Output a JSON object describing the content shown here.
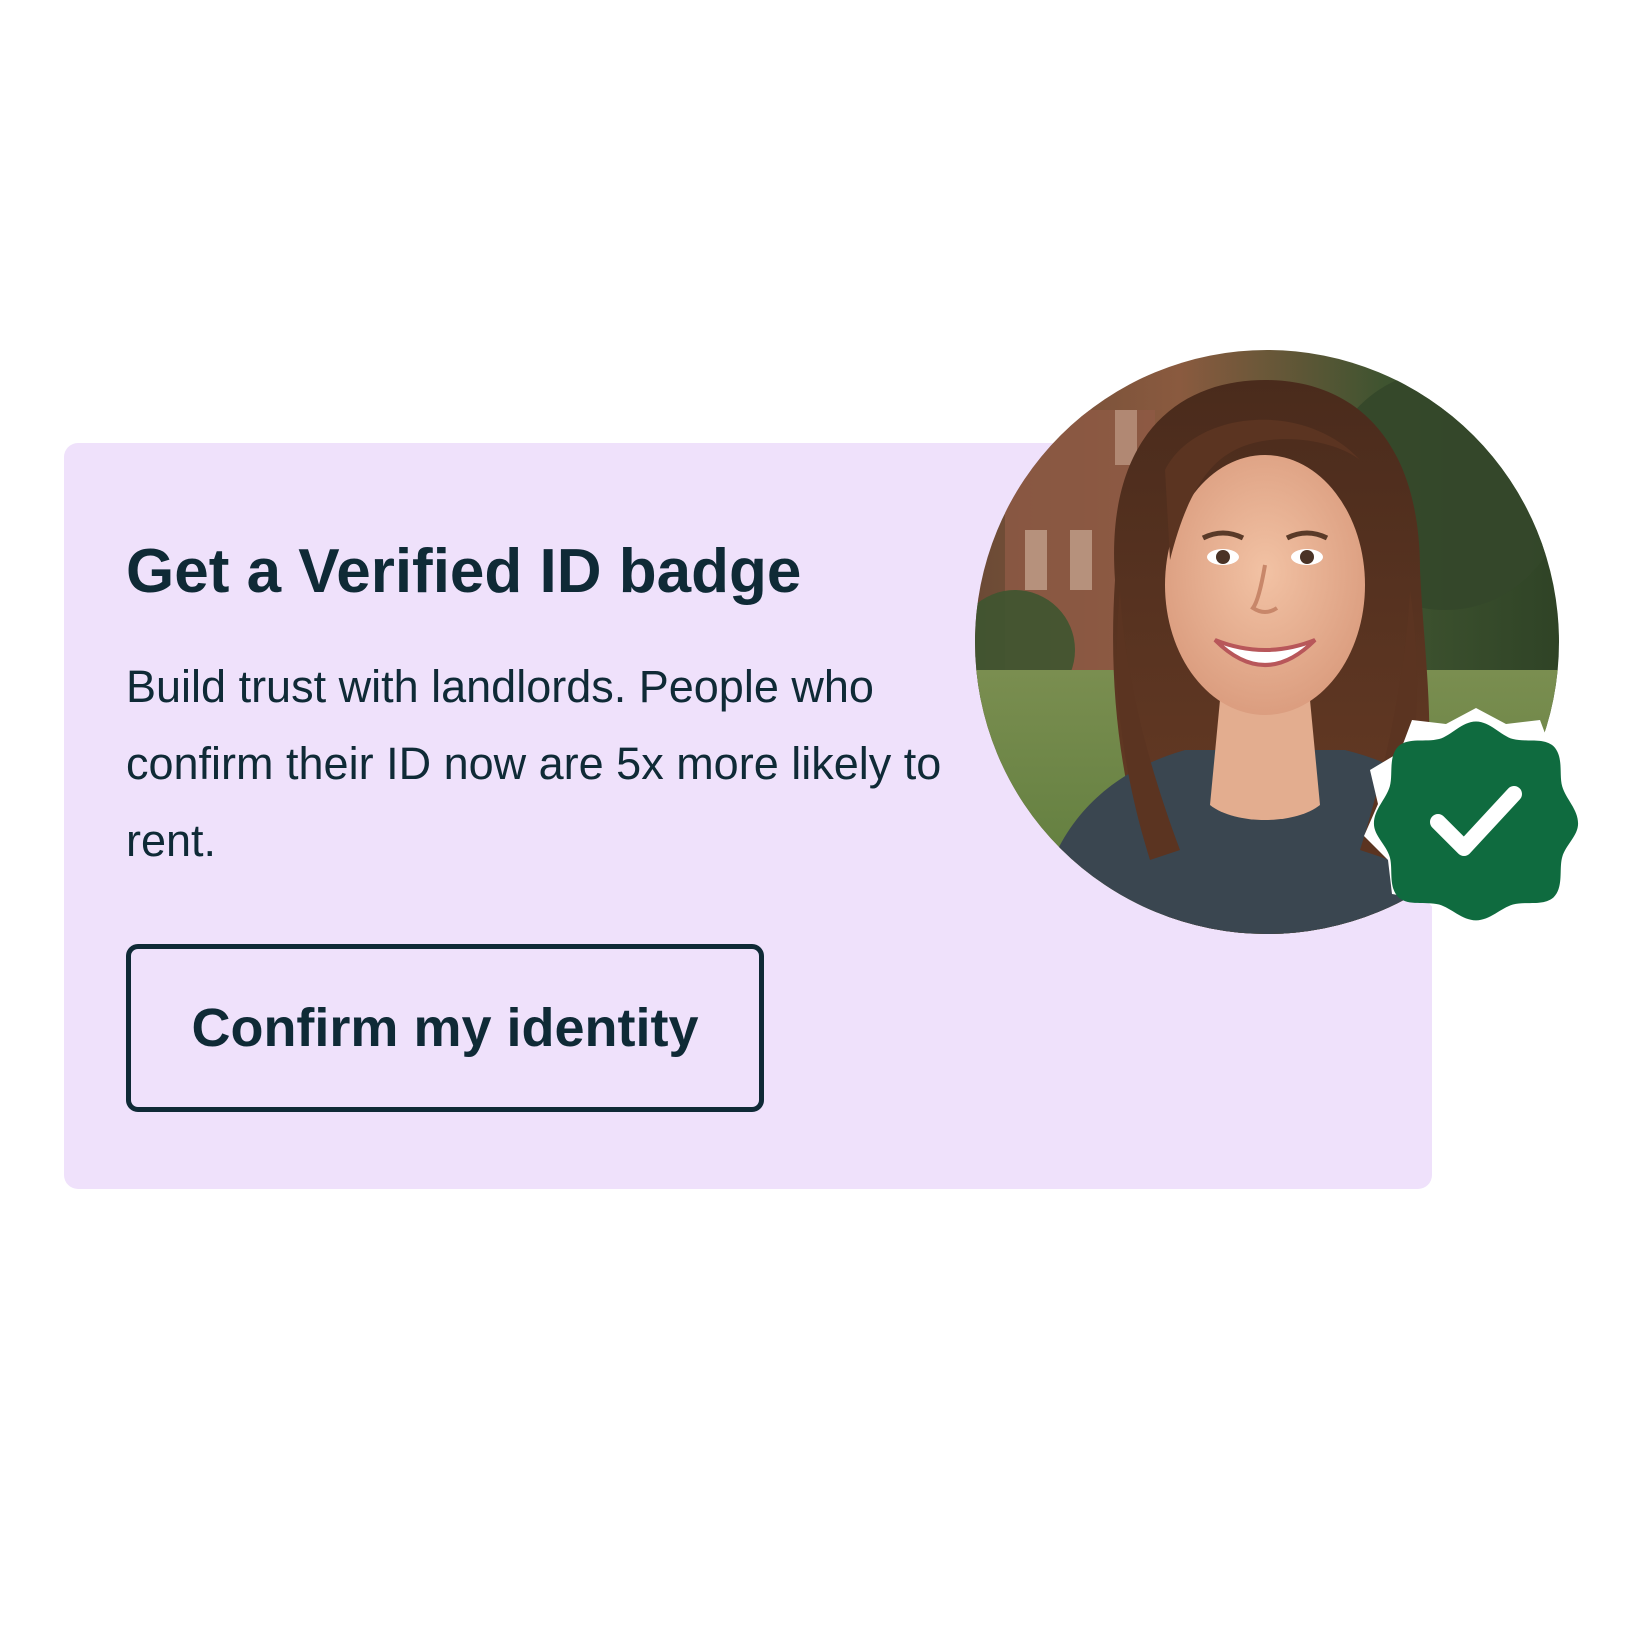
{
  "card": {
    "title": "Get a Verified ID badge",
    "description": "Build trust with landlords. People who confirm their ID now are 5x more likely to rent.",
    "cta_label": "Confirm my identity"
  },
  "icons": {
    "portrait": "person-photo",
    "verified_badge": "verified-check-badge-icon"
  },
  "colors": {
    "card_background": "#efe1fb",
    "text": "#0f2a36",
    "badge_green": "#0f6b3f"
  }
}
